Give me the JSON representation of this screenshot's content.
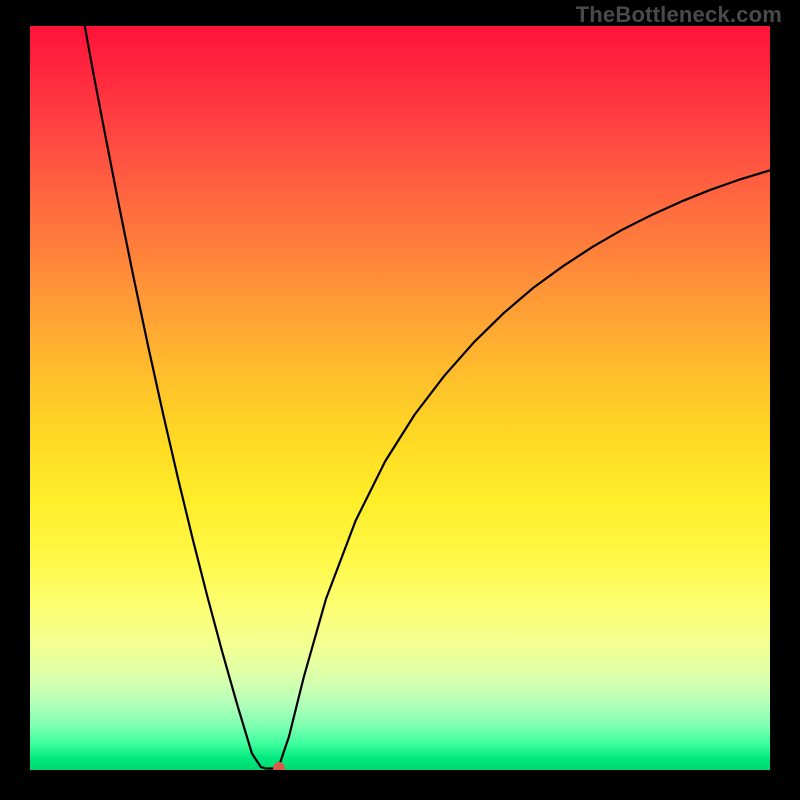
{
  "watermark": {
    "text": "TheBottleneck.com"
  },
  "chart_data": {
    "type": "line",
    "title": "",
    "xlabel": "",
    "ylabel": "",
    "xlim": [
      0,
      100
    ],
    "ylim": [
      0,
      100
    ],
    "grid": false,
    "series": [
      {
        "name": "left-branch",
        "x": [
          7.4,
          8.5,
          10,
          12,
          14,
          16,
          18,
          20,
          22,
          24,
          26,
          28,
          30,
          31.2,
          31.9,
          32.8,
          33.6
        ],
        "y": [
          100,
          94,
          86.2,
          76,
          66.2,
          56.8,
          47.8,
          39.2,
          31.0,
          23.2,
          15.8,
          8.8,
          2.2,
          0.4,
          0.2,
          0.2,
          0.4
        ]
      },
      {
        "name": "right-branch",
        "x": [
          33.6,
          35,
          37,
          40,
          44,
          48,
          52,
          56,
          60,
          64,
          68,
          72,
          76,
          80,
          84,
          88,
          92,
          96,
          100
        ],
        "y": [
          0.4,
          4.5,
          12.5,
          23.0,
          33.5,
          41.5,
          47.8,
          53.0,
          57.5,
          61.4,
          64.8,
          67.7,
          70.3,
          72.6,
          74.6,
          76.4,
          78.0,
          79.4,
          80.6
        ]
      }
    ],
    "annotations": [
      {
        "name": "optimal-marker",
        "x": 33.6,
        "y": 0.2
      }
    ],
    "background_gradient": {
      "top": "#ff123a",
      "mid": "#ffee2a",
      "bottom": "#00d86e"
    }
  }
}
